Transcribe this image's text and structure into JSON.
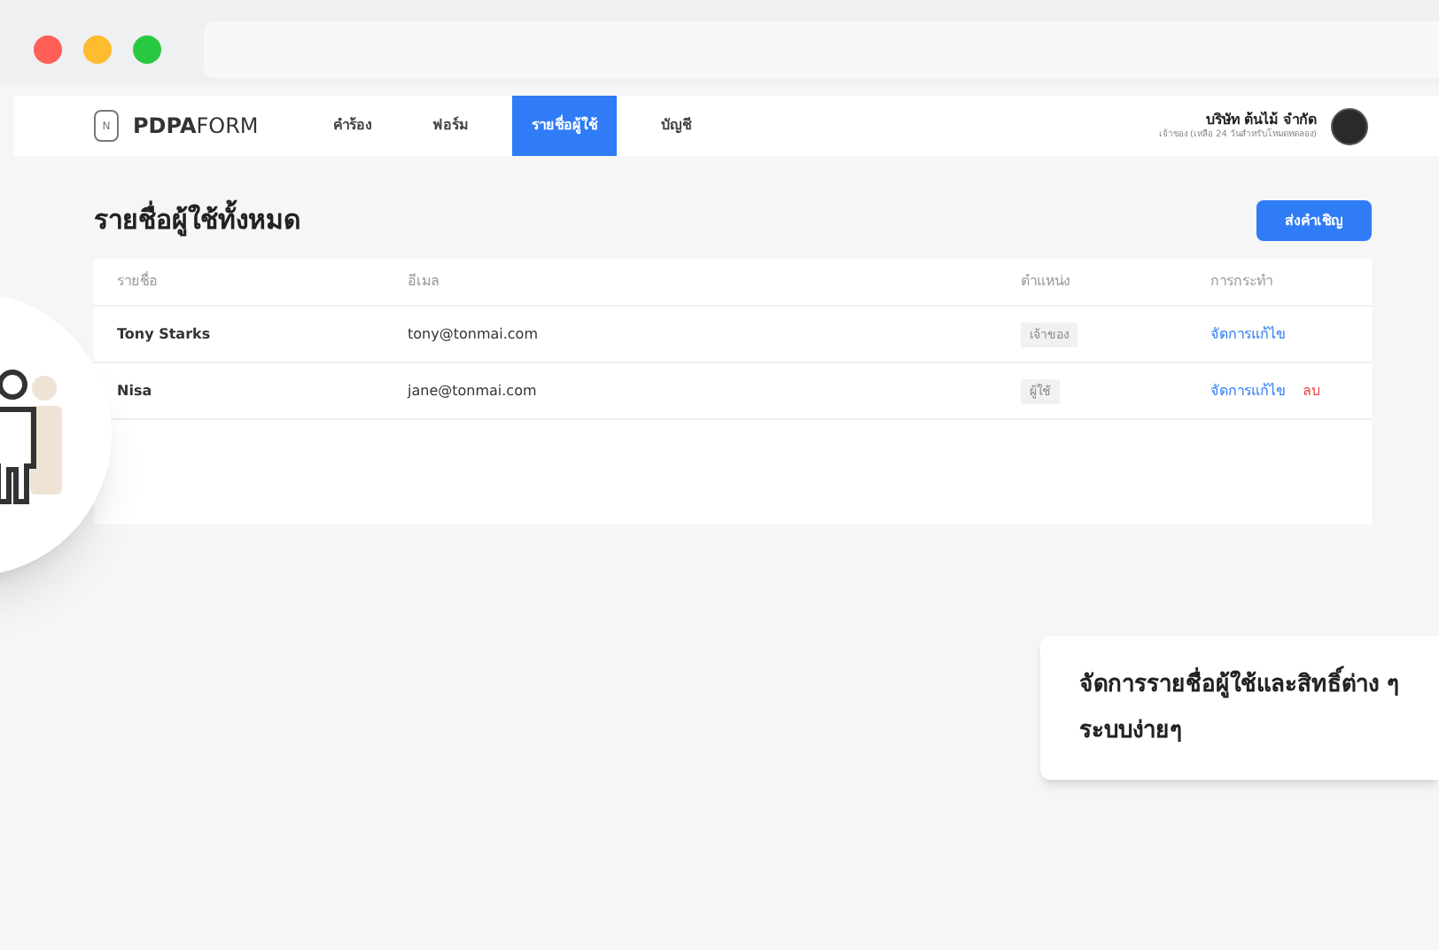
{
  "browser": {
    "buttons": [
      {
        "color": "#ff5f57"
      },
      {
        "color": "#febc2e"
      },
      {
        "color": "#28c840"
      }
    ]
  },
  "nav": {
    "logo_bold": "PDPA",
    "logo_light": "FORM",
    "logo_mark": "N",
    "items": [
      {
        "label": "คำร้อง",
        "selected": false
      },
      {
        "label": "ฟอร์ม",
        "selected": false
      },
      {
        "label": "รายชื่อผู้ใช้",
        "selected": true
      },
      {
        "label": "บัญชี",
        "selected": false
      }
    ],
    "company": "บริษัท ต้นไม้ จำกัด",
    "company_note": "เจ้าของ (เหลือ 24 วันสำหรับโหมดทดลอง)"
  },
  "page": {
    "title": "รายชื่อผู้ใช้ทั้งหมด",
    "invite_button": "ส่งคำเชิญ"
  },
  "table": {
    "columns": [
      "รายชื่อ",
      "อีเมล",
      "ตำแหน่ง",
      "การกระทำ"
    ],
    "rows": [
      {
        "name": "Tony Starks",
        "email": "tony@tonmai.com",
        "role": "เจ้าของ",
        "actions": [
          {
            "label": "จัดการแก้ไข",
            "kind": "edit"
          }
        ]
      },
      {
        "name": "Nisa",
        "email": "jane@tonmai.com",
        "role": "ผู้ใช้",
        "actions": [
          {
            "label": "จัดการแก้ไข",
            "kind": "edit"
          },
          {
            "label": "ลบ",
            "kind": "delete"
          }
        ]
      }
    ]
  },
  "callout": {
    "lines": [
      "จัดการรายชื่อผู้ใช้และสิทธิ์ต่าง ๆ",
      "ระบบง่ายๆ"
    ]
  }
}
